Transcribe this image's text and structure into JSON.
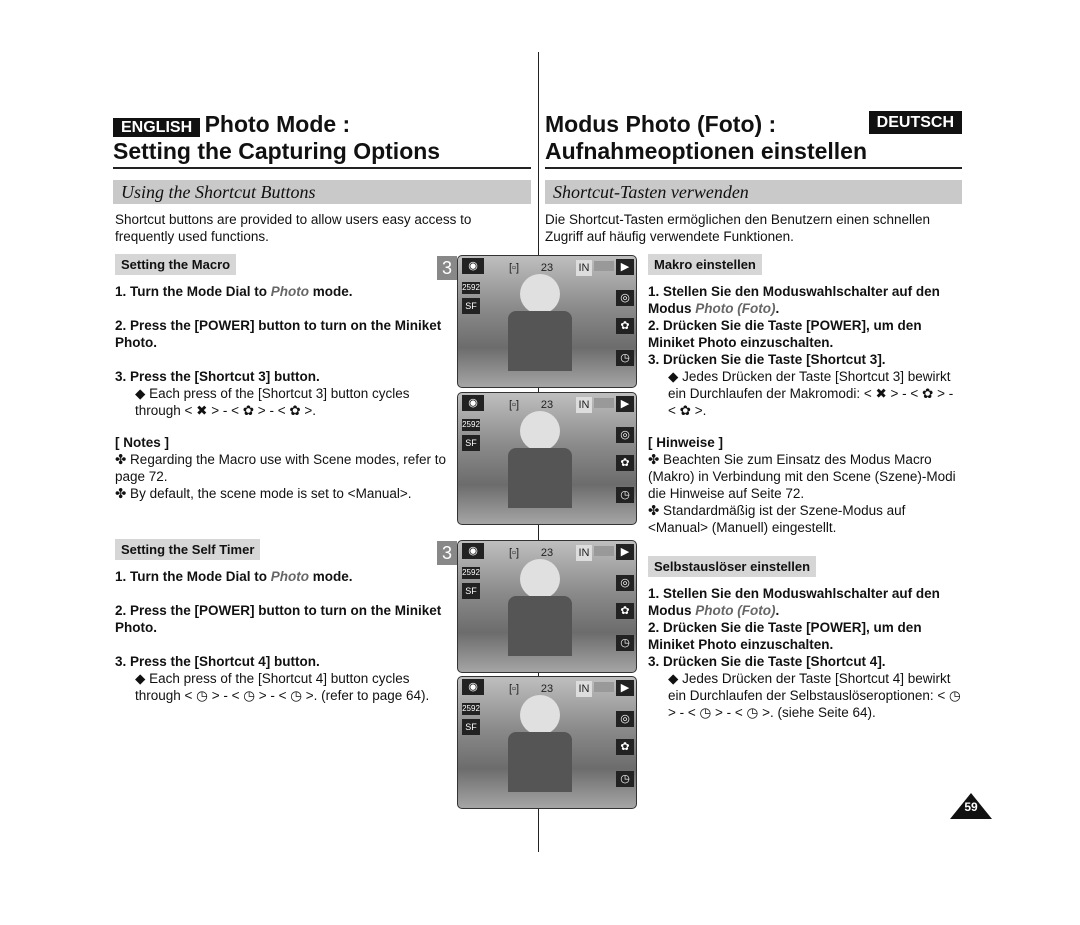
{
  "header": {
    "lang_en": "ENGLISH",
    "title_en_1": "Photo Mode :",
    "title_en_2": "Setting the Capturing Options",
    "lang_de": "DEUTSCH",
    "title_de_1": "Modus Photo (Foto) :",
    "title_de_2": "Aufnahmeoptionen einstellen"
  },
  "sections": {
    "en": "Using the Shortcut Buttons",
    "de": "Shortcut-Tasten verwenden"
  },
  "intro": {
    "en": "Shortcut buttons are provided to allow users easy access to frequently used functions.",
    "de": "Die Shortcut-Tasten ermöglichen den Benutzern einen schnellen Zugriff auf häufig verwendete Funktionen."
  },
  "macro_en": {
    "heading": "Setting the Macro",
    "s1a": "1.  Turn the Mode Dial to ",
    "s1b": "Photo",
    "s1c": " mode.",
    "s2": "2.  Press the [POWER] button to turn on the Miniket Photo.",
    "s3": "3.  Press the [Shortcut 3] button.",
    "bullet": "◆  Each press of the [Shortcut 3] button cycles through < ✖ > - < ✿ > - < ✿ >.",
    "notes": "[ Notes ]",
    "n1": "✤  Regarding the Macro use with Scene modes, refer to page 72.",
    "n2": "✤  By default, the scene mode is set to <Manual>."
  },
  "macro_de": {
    "heading": "Makro einstellen",
    "s1a": "1.  Stellen Sie den Moduswahlschalter auf den Modus ",
    "s1b": "Photo (Foto)",
    "s1c": ".",
    "s2": "2.  Drücken Sie die Taste [POWER], um den Miniket Photo einzuschalten.",
    "s3": "3.  Drücken Sie die Taste [Shortcut 3].",
    "bullet": "◆  Jedes Drücken der Taste [Shortcut 3] bewirkt ein Durchlaufen der Makromodi: < ✖ > - < ✿ > - < ✿ >.",
    "notes": "[ Hinweise ]",
    "n1": "✤  Beachten Sie zum Einsatz des Modus Macro (Makro) in Verbindung mit den Scene (Szene)-Modi die Hinweise auf Seite 72.",
    "n2": "✤  Standardmäßig ist der Szene-Modus auf <Manual> (Manuell) eingestellt."
  },
  "timer_en": {
    "heading": "Setting the Self Timer",
    "s1a": "1.  Turn the Mode Dial to ",
    "s1b": "Photo",
    "s1c": " mode.",
    "s2": "2.  Press the [POWER] button to turn on the Miniket Photo.",
    "s3": "3.  Press the [Shortcut 4] button.",
    "bullet": "◆  Each press of the [Shortcut 4] button cycles through < ◷ > - < ◷ > - < ◷ >. (refer to page 64)."
  },
  "timer_de": {
    "heading": "Selbstauslöser einstellen",
    "s1a": "1.  Stellen Sie den Moduswahlschalter auf den Modus ",
    "s1b": "Photo (Foto)",
    "s1c": ".",
    "s2": "2.  Drücken Sie die Taste [POWER], um den Miniket Photo einzuschalten.",
    "s3": "3.  Drücken Sie die Taste [Shortcut 4].",
    "bullet": "◆  Jedes Drücken der Taste [Shortcut 4] bewirkt ein Durchlaufen der Selbstauslöseroptionen: < ◷ > - < ◷ > - < ◷ >. (siehe Seite 64)."
  },
  "screen": {
    "step": "3",
    "count": "23",
    "memory": "IN"
  },
  "page_number": "59"
}
